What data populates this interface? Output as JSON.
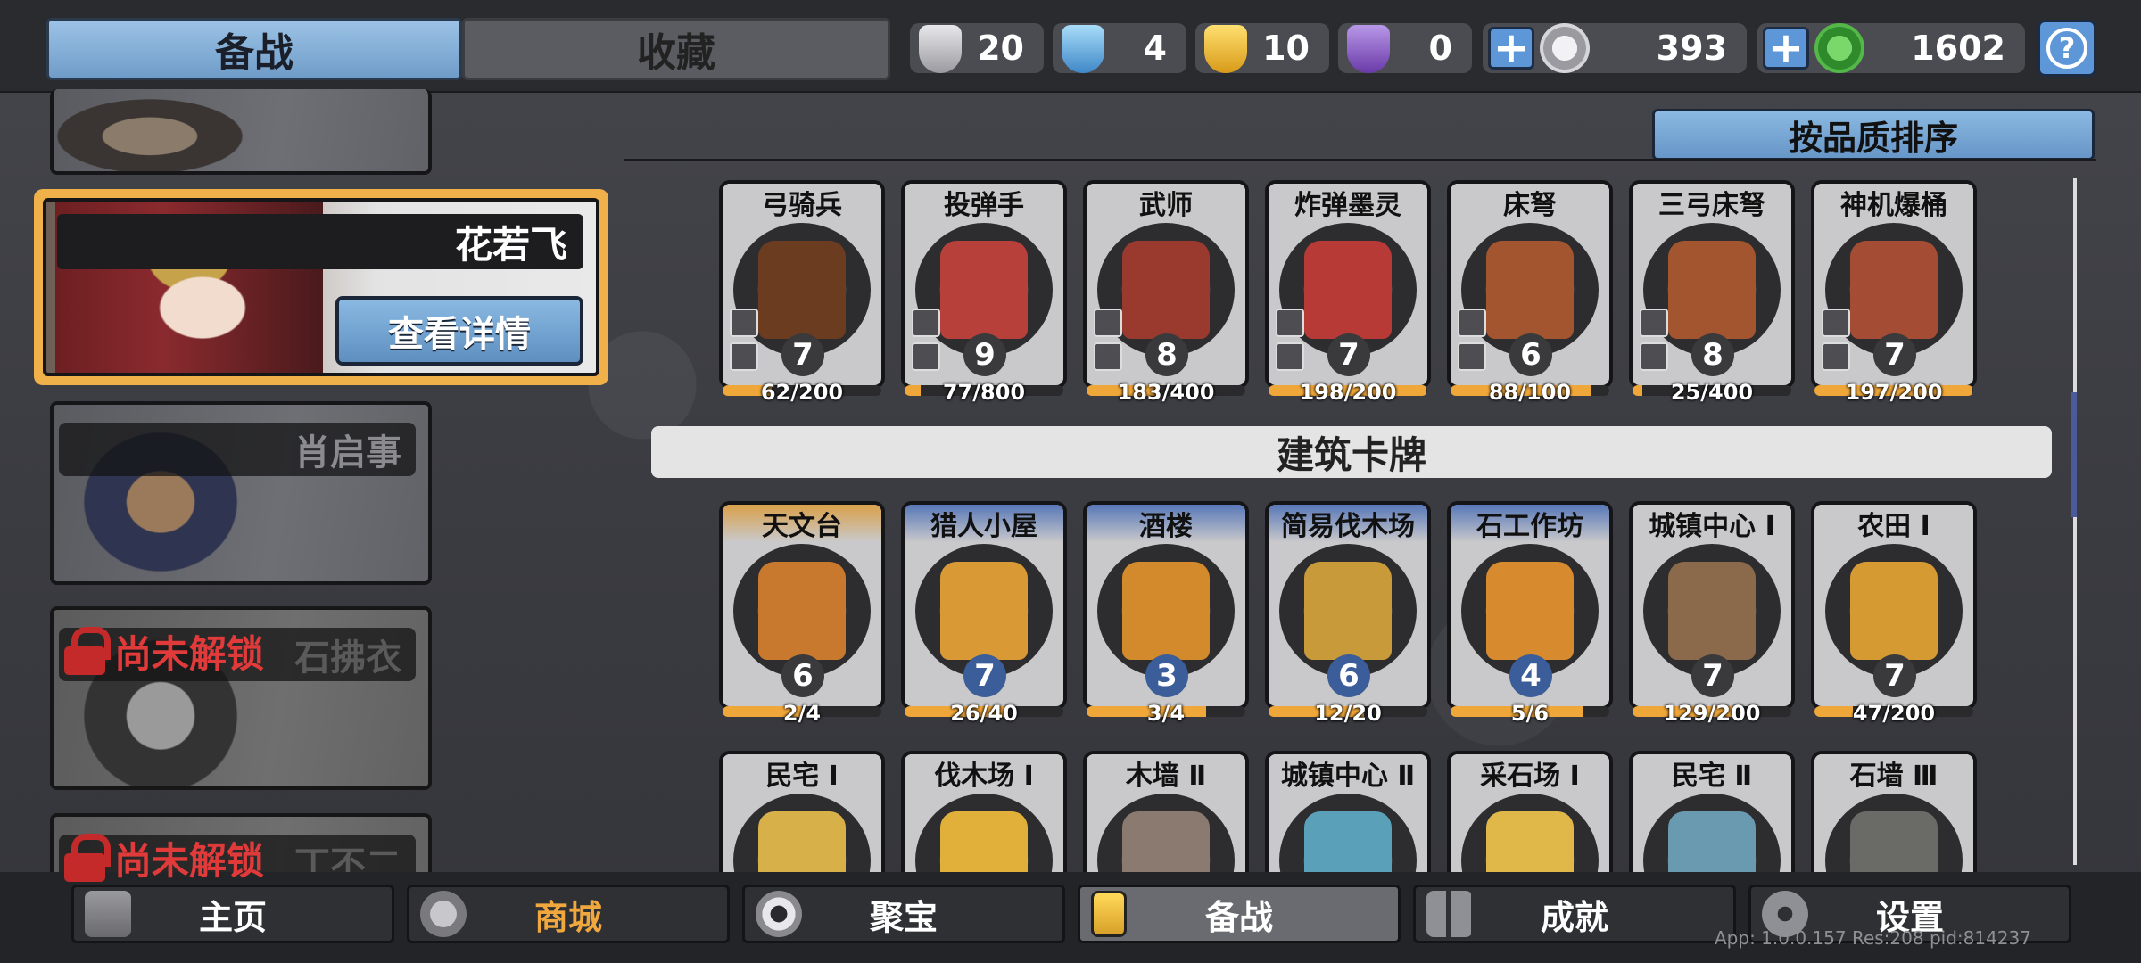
{
  "top_tabs": {
    "active": "备战",
    "inactive": "收藏"
  },
  "resources": [
    {
      "icon": "silver-shield-icon",
      "value": "20",
      "color": "#c8c8cc"
    },
    {
      "icon": "blue-shield-icon",
      "value": "4",
      "color": "#6fb5e8"
    },
    {
      "icon": "gold-shield-icon",
      "value": "10",
      "color": "#f0c030"
    },
    {
      "icon": "purple-shield-icon",
      "value": "0",
      "color": "#8a5ac8"
    }
  ],
  "currencies": [
    {
      "icon": "silver-coin-icon",
      "value": "393",
      "color": "#d0d0d4"
    },
    {
      "icon": "green-coin-icon",
      "value": "1602",
      "color": "#3da83a"
    }
  ],
  "heroes": {
    "selected": {
      "name": "花若飞",
      "detail_button": "查看详情"
    },
    "list": [
      {
        "name": "肖启事",
        "locked": false
      },
      {
        "name": "石拂衣",
        "locked": true,
        "lock_text": "尚未解锁"
      },
      {
        "name": "丁不二",
        "locked": true,
        "lock_text": "尚未解锁"
      }
    ]
  },
  "sort_button": "按品质排序",
  "unit_cards": [
    {
      "name": "弓骑兵",
      "level": "7",
      "progress_text": "62/200",
      "progress": 0.31,
      "art": "#6b3c1f"
    },
    {
      "name": "投弹手",
      "level": "9",
      "progress_text": "77/800",
      "progress": 0.1,
      "art": "#b8403a"
    },
    {
      "name": "武师",
      "level": "8",
      "progress_text": "183/400",
      "progress": 0.46,
      "art": "#9a3a2f"
    },
    {
      "name": "炸弹墨灵",
      "level": "7",
      "progress_text": "198/200",
      "progress": 0.99,
      "art": "#b83a36"
    },
    {
      "name": "床弩",
      "level": "6",
      "progress_text": "88/100",
      "progress": 0.88,
      "art": "#a2552e"
    },
    {
      "name": "三弓床弩",
      "level": "8",
      "progress_text": "25/400",
      "progress": 0.06,
      "art": "#a2552e"
    },
    {
      "name": "神机爆桶",
      "level": "7",
      "progress_text": "197/200",
      "progress": 0.99,
      "art": "#a44d34"
    }
  ],
  "building_section_title": "建筑卡牌",
  "building_cards": [
    {
      "name": "天文台",
      "level": "6",
      "progress_text": "2/4",
      "progress": 0.5,
      "tier": "gold",
      "art": "#c9792e"
    },
    {
      "name": "猎人小屋",
      "level": "7",
      "progress_text": "26/40",
      "progress": 0.65,
      "tier": "blue",
      "art": "#d99a36"
    },
    {
      "name": "酒楼",
      "level": "3",
      "progress_text": "3/4",
      "progress": 0.75,
      "tier": "blue",
      "art": "#d28a2c"
    },
    {
      "name": "简易伐木场",
      "level": "6",
      "progress_text": "12/20",
      "progress": 0.6,
      "tier": "blue",
      "art": "#c99a3a"
    },
    {
      "name": "石工作坊",
      "level": "4",
      "progress_text": "5/6",
      "progress": 0.83,
      "tier": "blue",
      "art": "#d88a2e"
    },
    {
      "name": "城镇中心 Ⅰ",
      "level": "7",
      "progress_text": "129/200",
      "progress": 0.65,
      "tier": "gray",
      "art": "#8a6a4a"
    },
    {
      "name": "农田 Ⅰ",
      "level": "7",
      "progress_text": "47/200",
      "progress": 0.24,
      "tier": "gray",
      "art": "#d69a32"
    }
  ],
  "building_cards_row2": [
    {
      "name": "民宅 Ⅰ",
      "art": "#d8b04a"
    },
    {
      "name": "伐木场 Ⅰ",
      "art": "#e0b03a"
    },
    {
      "name": "木墙 Ⅱ",
      "art": "#8a7a70"
    },
    {
      "name": "城镇中心 Ⅱ",
      "art": "#5aa0b8"
    },
    {
      "name": "采石场 Ⅰ",
      "art": "#e0b84a"
    },
    {
      "name": "民宅 Ⅱ",
      "art": "#6a9ab0"
    },
    {
      "name": "石墙 Ⅲ",
      "art": "#6a6a66"
    }
  ],
  "bottom_nav": [
    {
      "label": "主页",
      "icon": "home-icon"
    },
    {
      "label": "商城",
      "icon": "shop-coins-icon"
    },
    {
      "label": "聚宝",
      "icon": "treasure-eye-icon"
    },
    {
      "label": "备战",
      "icon": "cards-icon"
    },
    {
      "label": "成就",
      "icon": "achievements-icon"
    },
    {
      "label": "设置",
      "icon": "gear-icon"
    }
  ],
  "version_text": "App: 1.0.0.157 Res:208 pid:814237"
}
